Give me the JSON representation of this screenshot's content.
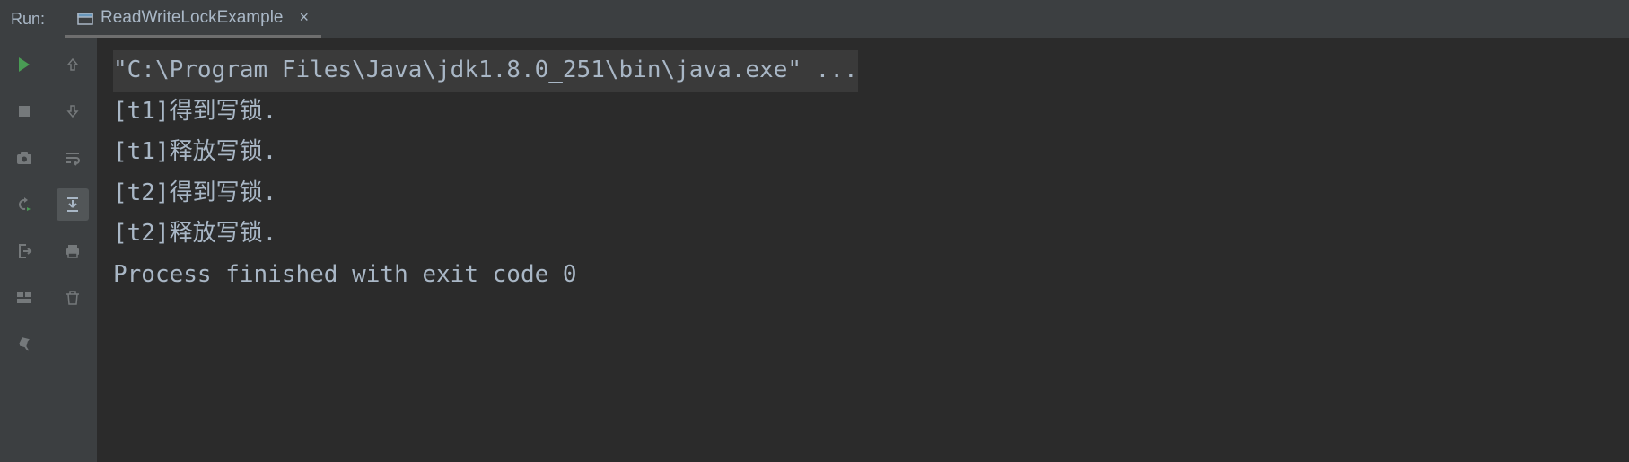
{
  "header": {
    "run_label": "Run:",
    "tab_name": "ReadWriteLockExample"
  },
  "sidebar_left": {
    "run_icon": "run-icon",
    "stop_icon": "stop-icon",
    "camera_icon": "camera-icon",
    "debug_icon": "debug-restart-icon",
    "exit_icon": "exit-icon",
    "layout_icon": "layout-icon",
    "pin_icon": "pin-icon"
  },
  "sidebar_right": {
    "up_icon": "arrow-up-icon",
    "down_icon": "arrow-down-icon",
    "wrap_icon": "soft-wrap-icon",
    "scroll_icon": "scroll-to-end-icon",
    "print_icon": "print-icon",
    "trash_icon": "trash-icon"
  },
  "console": {
    "lines": [
      "\"C:\\Program Files\\Java\\jdk1.8.0_251\\bin\\java.exe\" ...",
      "[t1]得到写锁.",
      "[t1]释放写锁.",
      "[t2]得到写锁.",
      "[t2]释放写锁.",
      "",
      "Process finished with exit code 0"
    ]
  }
}
